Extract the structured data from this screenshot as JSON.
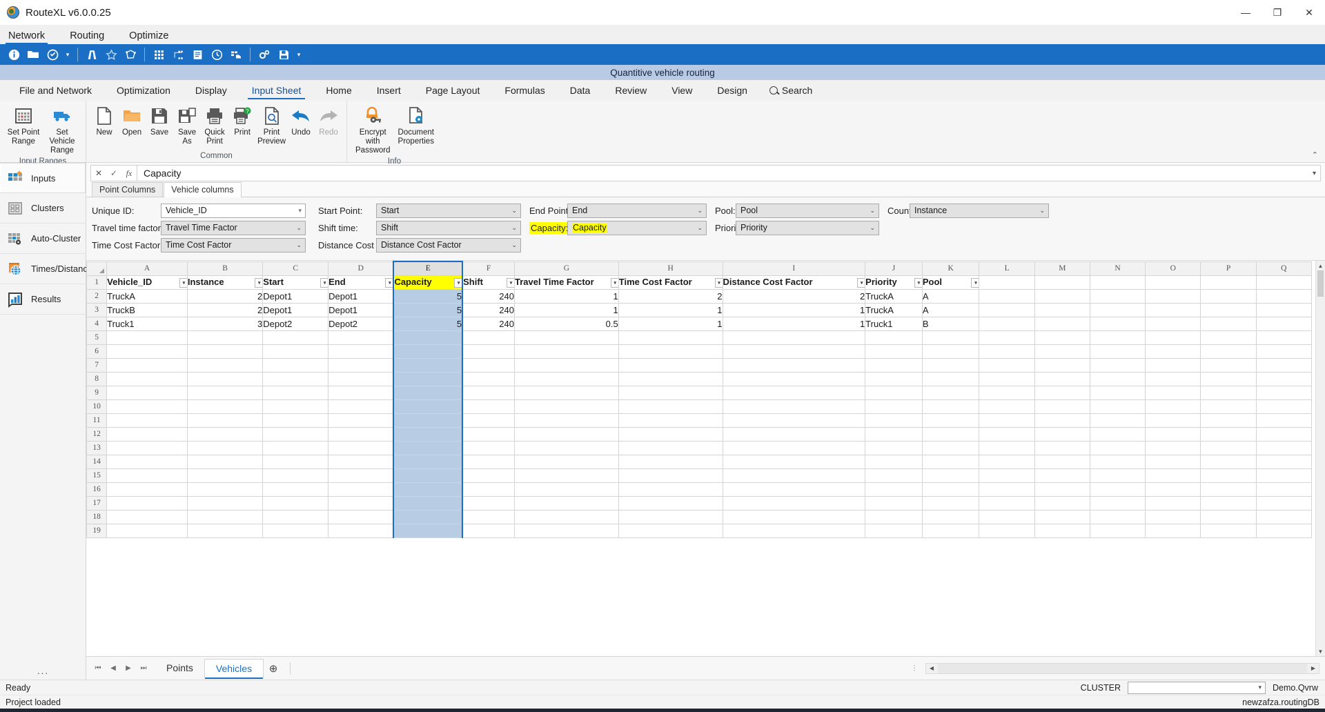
{
  "window": {
    "title": "RouteXL v6.0.0.25",
    "app_icon": "globe-icon",
    "minimize": "—",
    "maximize": "❐",
    "close": "✕"
  },
  "menu": {
    "items": [
      {
        "label": "Network",
        "active": true
      },
      {
        "label": "Routing",
        "active": false
      },
      {
        "label": "Optimize",
        "active": false
      }
    ]
  },
  "quick_toolbar": {
    "icons": [
      "info-icon",
      "folder-icon",
      "compass-icon",
      "chevron-down-icon",
      "road-icon",
      "star-outline-icon",
      "polygon-icon",
      "grid-dots-icon",
      "network-nodes-icon",
      "document-lines-icon",
      "clock-icon",
      "truck-list-icon",
      "gears-icon",
      "save-icon",
      "chevron-down-small-icon"
    ]
  },
  "document_band": {
    "title": "Quantitive vehicle routing"
  },
  "ribbon_tabs": {
    "items": [
      {
        "label": "File and Network",
        "active": false
      },
      {
        "label": "Optimization",
        "active": false
      },
      {
        "label": "Display",
        "active": false
      },
      {
        "label": "Input Sheet",
        "active": true
      },
      {
        "label": "Home",
        "active": false
      },
      {
        "label": "Insert",
        "active": false
      },
      {
        "label": "Page Layout",
        "active": false
      },
      {
        "label": "Formulas",
        "active": false
      },
      {
        "label": "Data",
        "active": false
      },
      {
        "label": "Review",
        "active": false
      },
      {
        "label": "View",
        "active": false
      },
      {
        "label": "Design",
        "active": false
      }
    ],
    "search_label": "Search",
    "search_icon": "magnifier-icon"
  },
  "ribbon": {
    "groups": [
      {
        "label": "Input Ranges",
        "items": [
          {
            "label": "Set Point Range",
            "icon": "point-grid-icon",
            "disabled": false
          },
          {
            "label": "Set Vehicle Range",
            "icon": "truck-icon",
            "disabled": false
          }
        ]
      },
      {
        "label": "Common",
        "items": [
          {
            "label": "New",
            "icon": "new-document-icon",
            "disabled": false
          },
          {
            "label": "Open",
            "icon": "open-folder-icon",
            "disabled": false
          },
          {
            "label": "Save",
            "icon": "floppy-save-icon",
            "disabled": false
          },
          {
            "label": "Save As",
            "icon": "floppy-save-as-icon",
            "disabled": false
          },
          {
            "label": "Quick Print",
            "icon": "printer-icon",
            "disabled": false
          },
          {
            "label": "Print",
            "icon": "printer-help-icon",
            "disabled": false
          },
          {
            "label": "Print Preview",
            "icon": "print-preview-icon",
            "disabled": false
          },
          {
            "label": "Undo",
            "icon": "undo-arrow-icon",
            "disabled": false
          },
          {
            "label": "Redo",
            "icon": "redo-arrow-icon",
            "disabled": true
          }
        ]
      },
      {
        "label": "Info",
        "items": [
          {
            "label": "Encrypt with Password",
            "icon": "lock-key-icon",
            "disabled": false
          },
          {
            "label": "Document Properties",
            "icon": "document-gear-icon",
            "disabled": false
          }
        ]
      }
    ],
    "collapse_icon": "chevron-up-icon"
  },
  "sidebar": {
    "items": [
      {
        "label": "Inputs",
        "icon": "inputs-grid-icon",
        "active": true
      },
      {
        "label": "Clusters",
        "icon": "clusters-squares-icon",
        "active": false
      },
      {
        "label": "Auto-Cluster",
        "icon": "auto-cluster-gear-icon",
        "active": false
      },
      {
        "label": "Times/Distances",
        "icon": "globe-book-icon",
        "active": false
      },
      {
        "label": "Results",
        "icon": "bar-chart-icon",
        "active": false
      }
    ],
    "overflow": "···"
  },
  "formula_bar": {
    "cancel_icon": "close-icon",
    "confirm_icon": "check-icon",
    "function_icon": "fx-icon",
    "value": "Capacity",
    "expand_icon": "chevron-down-icon"
  },
  "column_tabs": {
    "items": [
      {
        "label": "Point Columns",
        "active": false
      },
      {
        "label": "Vehicle columns",
        "active": true
      }
    ]
  },
  "settings": {
    "fields": [
      {
        "label": "Unique ID:",
        "value": "Vehicle_ID",
        "style": "white",
        "highlight": false
      },
      {
        "label": "Start Point:",
        "value": "Start",
        "style": "grey",
        "highlight": false
      },
      {
        "label": "End Point:",
        "value": "End",
        "style": "grey",
        "highlight": false
      },
      {
        "label": "Pool:",
        "value": "Pool",
        "style": "grey",
        "highlight": false
      },
      {
        "label": "Count:",
        "value": "Instance",
        "style": "grey",
        "highlight": false
      },
      {
        "label": "Travel time factor:",
        "value": "Travel Time Factor",
        "style": "grey",
        "highlight": false
      },
      {
        "label": "Shift time:",
        "value": "Shift",
        "style": "grey",
        "highlight": false
      },
      {
        "label": "Capacity:",
        "value": "Capacity",
        "style": "grey",
        "highlight": true
      },
      {
        "label": "Priority",
        "value": "Priority",
        "style": "grey",
        "highlight": false
      },
      {
        "label": "Time Cost Factor:",
        "value": "Time Cost Factor",
        "style": "grey",
        "highlight": false
      },
      {
        "label": "Distance Cost Factor:",
        "value": "Distance Cost Factor",
        "style": "grey",
        "highlight": false
      }
    ]
  },
  "spreadsheet": {
    "column_letters": [
      "A",
      "B",
      "C",
      "D",
      "E",
      "F",
      "G",
      "H",
      "I",
      "J",
      "K",
      "L",
      "M",
      "N",
      "O",
      "P",
      "Q"
    ],
    "selected_column": "E",
    "header_row_number": "1",
    "headers": [
      "Vehicle_ID",
      "Instance",
      "Start",
      "End",
      "Capacity",
      "Shift",
      "Travel Time Factor",
      "Time Cost Factor",
      "Distance Cost Factor",
      "Priority",
      "Pool"
    ],
    "rows": [
      {
        "n": "2",
        "cells": [
          "TruckA",
          "2",
          "Depot1",
          "Depot1",
          "5",
          "240",
          "1",
          "2",
          "2",
          "TruckA",
          "A"
        ]
      },
      {
        "n": "3",
        "cells": [
          "TruckB",
          "2",
          "Depot1",
          "Depot1",
          "5",
          "240",
          "1",
          "1",
          "1",
          "TruckA",
          "A"
        ]
      },
      {
        "n": "4",
        "cells": [
          "Truck1",
          "3",
          "Depot2",
          "Depot2",
          "5",
          "240",
          "0.5",
          "1",
          "1",
          "Truck1",
          "B"
        ]
      }
    ],
    "empty_rows": [
      "5",
      "6",
      "7",
      "8",
      "9",
      "10",
      "11",
      "12",
      "13",
      "14",
      "15",
      "16",
      "17",
      "18",
      "19"
    ],
    "filter_icon": "filter-dropdown-icon"
  },
  "sheet_tabs": {
    "nav": [
      "first-icon",
      "prev-icon",
      "next-icon",
      "last-icon"
    ],
    "items": [
      {
        "label": "Points",
        "active": false
      },
      {
        "label": "Vehicles",
        "active": true
      }
    ],
    "add_label": "⊕",
    "add_icon": "add-sheet-icon"
  },
  "status": {
    "ready": "Ready",
    "cluster_label": "CLUSTER",
    "cluster_value": "",
    "demo": "Demo.Qvrw",
    "project": "Project loaded",
    "db": "newzafza.routingDB"
  },
  "colors": {
    "accent": "#1a6fc4",
    "highlight": "#ffff00",
    "selection": "#b8cce4",
    "band": "#b9cbe4"
  }
}
